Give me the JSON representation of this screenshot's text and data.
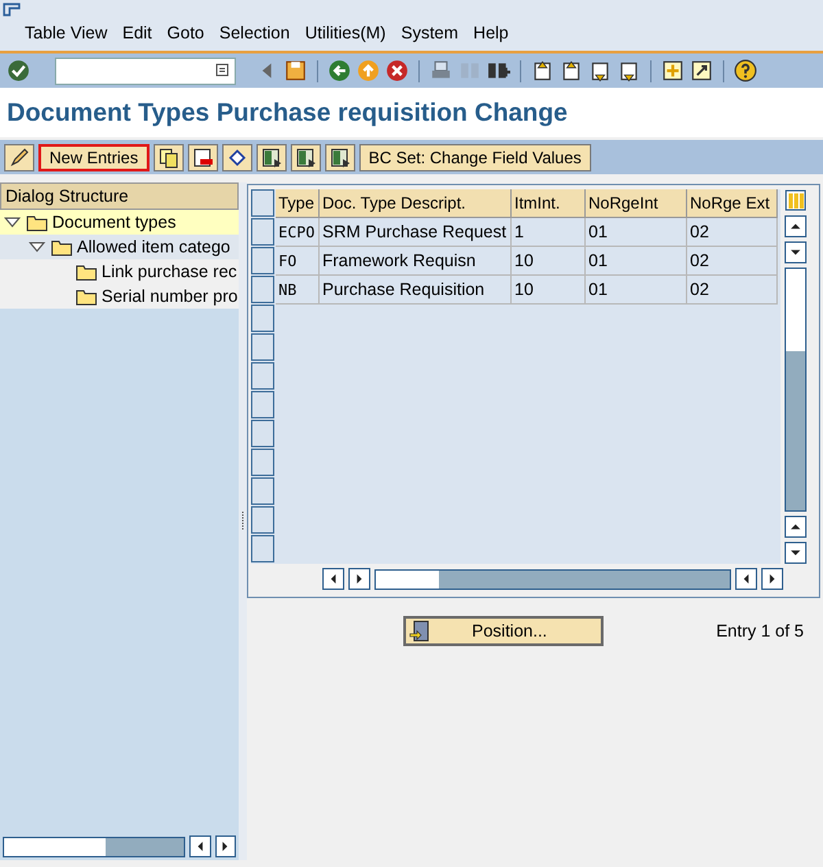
{
  "menu": [
    "Table View",
    "Edit",
    "Goto",
    "Selection",
    "Utilities(M)",
    "System",
    "Help"
  ],
  "standard_toolbar": {
    "buttons": [
      {
        "disabled": false
      },
      {
        "disabled": false
      },
      {
        "disabled": false
      },
      {
        "disabled": false
      },
      {
        "disabled": false
      },
      {
        "disabled": false
      },
      {
        "disabled": true
      },
      {
        "disabled": true
      },
      {
        "disabled": false
      },
      {
        "disabled": false
      },
      {
        "disabled": false
      },
      {
        "disabled": false
      },
      {
        "disabled": false
      },
      {
        "disabled": false
      },
      {
        "disabled": false
      },
      {
        "disabled": false
      }
    ]
  },
  "title": "Document Types Purchase requisition Change",
  "app_toolbar": {
    "buttons": [
      {
        "kind": "icon"
      },
      {
        "kind": "text",
        "label": "New Entries",
        "highlighted": true
      },
      {
        "kind": "icon"
      },
      {
        "kind": "icon"
      },
      {
        "kind": "icon"
      },
      {
        "kind": "icon"
      },
      {
        "kind": "icon"
      },
      {
        "kind": "icon"
      },
      {
        "kind": "text",
        "label": "BC Set: Change Field Values",
        "highlighted": false
      }
    ]
  },
  "dialog_structure": {
    "title": "Dialog Structure",
    "items": [
      {
        "label": "Document types",
        "expanded": true,
        "selected": true,
        "children": [
          {
            "label": "Allowed item catego",
            "expanded": true,
            "selected": false,
            "children": [
              {
                "label": "Link purchase rec",
                "selected": false
              },
              {
                "label": "Serial number pro",
                "selected": false
              }
            ]
          }
        ]
      }
    ]
  },
  "table": {
    "columns": [
      "Type",
      "Doc. Type Descript.",
      "ItmInt.",
      "NoRgeInt",
      "NoRge Ext"
    ],
    "rows": [
      [
        "ECPO",
        "SRM Purchase Request",
        "1",
        "01",
        "02"
      ],
      [
        "FO",
        "Framework Requisn",
        "10",
        "01",
        "02"
      ],
      [
        "NB",
        "Purchase Requisition",
        "10",
        "01",
        "02"
      ]
    ]
  },
  "position_button": "Position...",
  "entry_count": "Entry 1 of 5"
}
